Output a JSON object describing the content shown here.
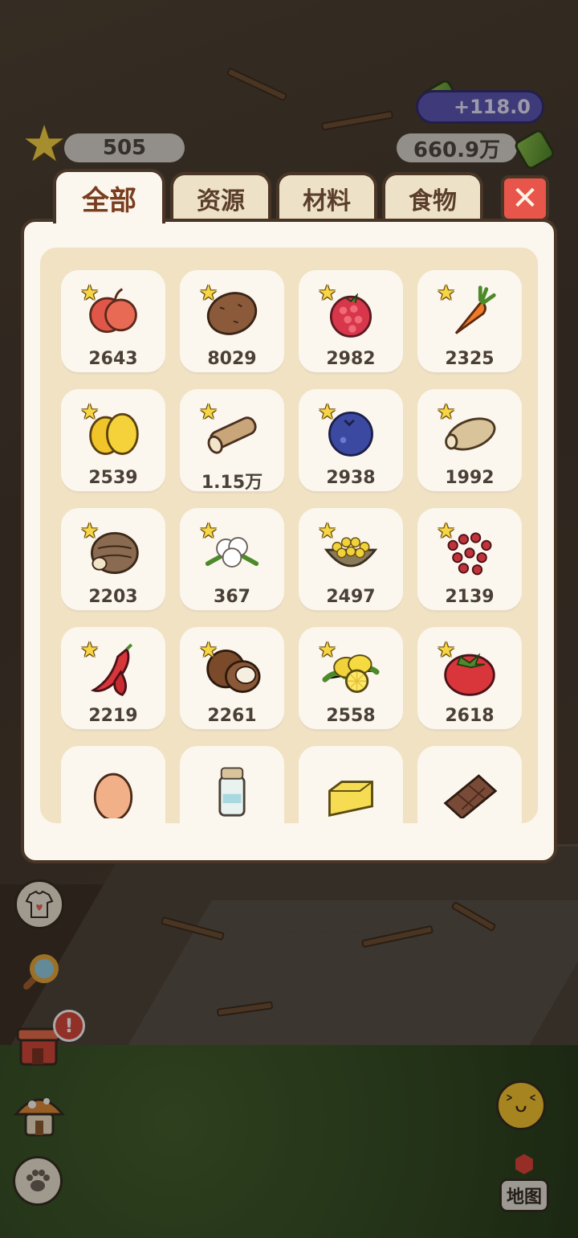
{
  "hud": {
    "star_count": "505",
    "money": "660.9万",
    "income": "+118.0"
  },
  "tabs": [
    {
      "label": "全部",
      "active": true
    },
    {
      "label": "资源",
      "active": false
    },
    {
      "label": "材料",
      "active": false
    },
    {
      "label": "食物",
      "active": false
    }
  ],
  "close_icon": "close-icon",
  "items": [
    {
      "name": "apple",
      "count": "2643",
      "starred": true
    },
    {
      "name": "sweet-potato",
      "count": "8029",
      "starred": true
    },
    {
      "name": "raspberry",
      "count": "2982",
      "starred": true
    },
    {
      "name": "carrot",
      "count": "2325",
      "starred": true
    },
    {
      "name": "mango",
      "count": "2539",
      "starred": true
    },
    {
      "name": "log",
      "count": "1.15万",
      "starred": true
    },
    {
      "name": "blueberry",
      "count": "2938",
      "starred": true
    },
    {
      "name": "yam",
      "count": "1992",
      "starred": true
    },
    {
      "name": "taro",
      "count": "2203",
      "starred": true
    },
    {
      "name": "cotton",
      "count": "367",
      "starred": true
    },
    {
      "name": "corn-bowl",
      "count": "2497",
      "starred": true
    },
    {
      "name": "red-berries",
      "count": "2139",
      "starred": true
    },
    {
      "name": "chili-pepper",
      "count": "2219",
      "starred": true
    },
    {
      "name": "coconut",
      "count": "2261",
      "starred": true
    },
    {
      "name": "lemon",
      "count": "2558",
      "starred": true
    },
    {
      "name": "tomato",
      "count": "2618",
      "starred": true
    },
    {
      "name": "egg",
      "count": "",
      "starred": false
    },
    {
      "name": "milk-bottle",
      "count": "",
      "starred": false
    },
    {
      "name": "butter",
      "count": "",
      "starred": false
    },
    {
      "name": "chocolate",
      "count": "",
      "starred": false
    }
  ],
  "side_buttons": [
    "shirt-icon",
    "magnifier-icon",
    "shop-icon",
    "mushroom-house-icon",
    "paw-icon"
  ],
  "alert_badge": "!",
  "map_label": "地图"
}
